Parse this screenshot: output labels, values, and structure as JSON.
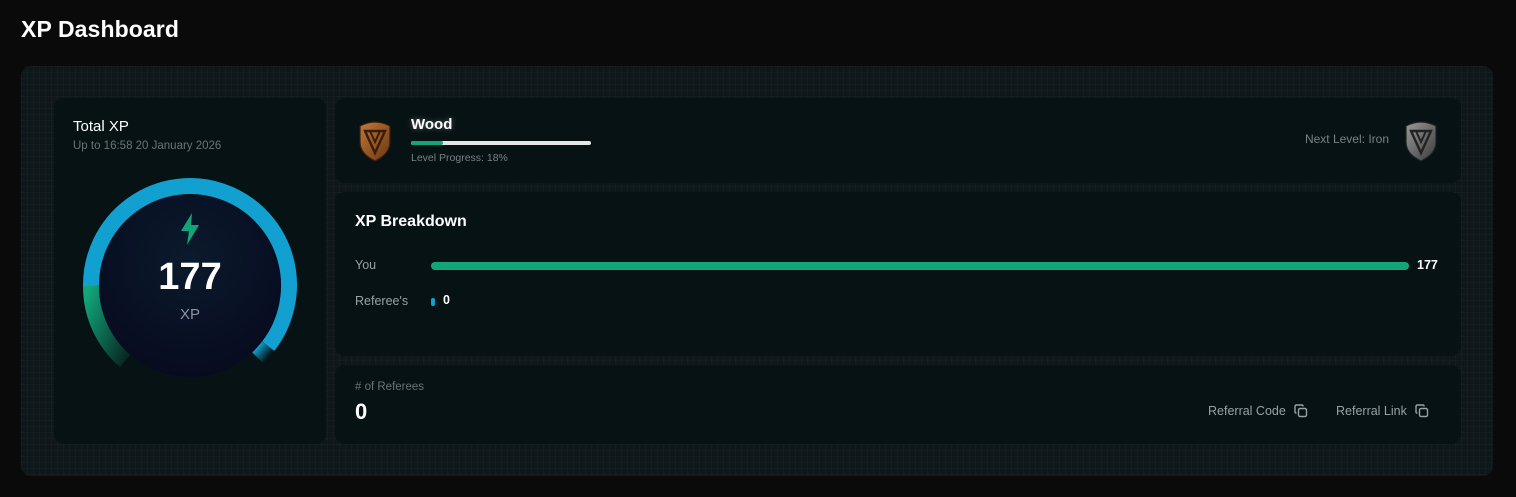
{
  "page": {
    "title": "XP Dashboard"
  },
  "total_xp": {
    "label": "Total XP",
    "subtitle": "Up to 16:58 20 January 2026",
    "value": "177",
    "unit": "XP",
    "gauge_colors": {
      "primary": "#12a0d0",
      "secondary": "#12a57a"
    }
  },
  "level": {
    "current": "Wood",
    "progress_label": "Level Progress: 18%",
    "progress_fraction": 0.18,
    "next_level_label": "Next Level: Iron",
    "current_icon": "wood-badge-icon",
    "next_icon": "iron-badge-icon"
  },
  "breakdown": {
    "title": "XP Breakdown",
    "rows": [
      {
        "label": "You",
        "value": "177",
        "fraction": 1.0,
        "color": "#12a57a"
      },
      {
        "label": "Referee's",
        "value": "0",
        "fraction": 0.0,
        "color": "#12a0d0"
      }
    ]
  },
  "referees": {
    "count_label": "# of Referees",
    "count": "0",
    "referral_code_label": "Referral Code",
    "referral_link_label": "Referral Link",
    "copy_icon": "copy-icon"
  }
}
